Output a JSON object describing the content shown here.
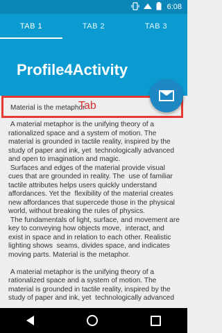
{
  "status_bar": {
    "time": "6:08",
    "icons": [
      "vibrate-icon",
      "signal-icon",
      "battery-icon"
    ]
  },
  "tabs": [
    {
      "label": "TAB 1",
      "active": true
    },
    {
      "label": "TAB 2",
      "active": false
    },
    {
      "label": "TAB 3",
      "active": false
    }
  ],
  "app": {
    "title": "Profile4Activity"
  },
  "tab_bar": {
    "label": "Material is the metaphor",
    "outline_caption": "Tab",
    "outline_color": "#e53935"
  },
  "fab": {
    "icon": "mail-icon",
    "color": "#1e88c4"
  },
  "content": {
    "text": " A material metaphor is the unifying theory of a rationalized space and a system of motion. The material is grounded in tactile reality, inspired by the study of paper and ink, yet  technologically advanced and open to imagination and magic.\n Surfaces and edges of the material provide visual cues that are grounded in reality. The  use of familiar tactile attributes helps users quickly understand affordances. Yet the  flexibility of the material creates new affordances that supercede those in the physical  world, without breaking the rules of physics.\n The fundamentals of light, surface, and movement are key to conveying how objects move,  interact, and exist in space and in relation to each other. Realistic lighting shows  seams, divides space, and indicates moving parts. Material is the metaphor.\n\n A material metaphor is the unifying theory of a rationalized space and a system of motion. The material is grounded in tactile reality, inspired by the study of paper and ink, yet  technologically advanced"
  },
  "colors": {
    "appbar": "#0b9bd0",
    "status_bar": "#0a86b8",
    "background": "#eeeeee"
  },
  "navigation": [
    "back-icon",
    "home-icon",
    "recent-apps-icon"
  ]
}
